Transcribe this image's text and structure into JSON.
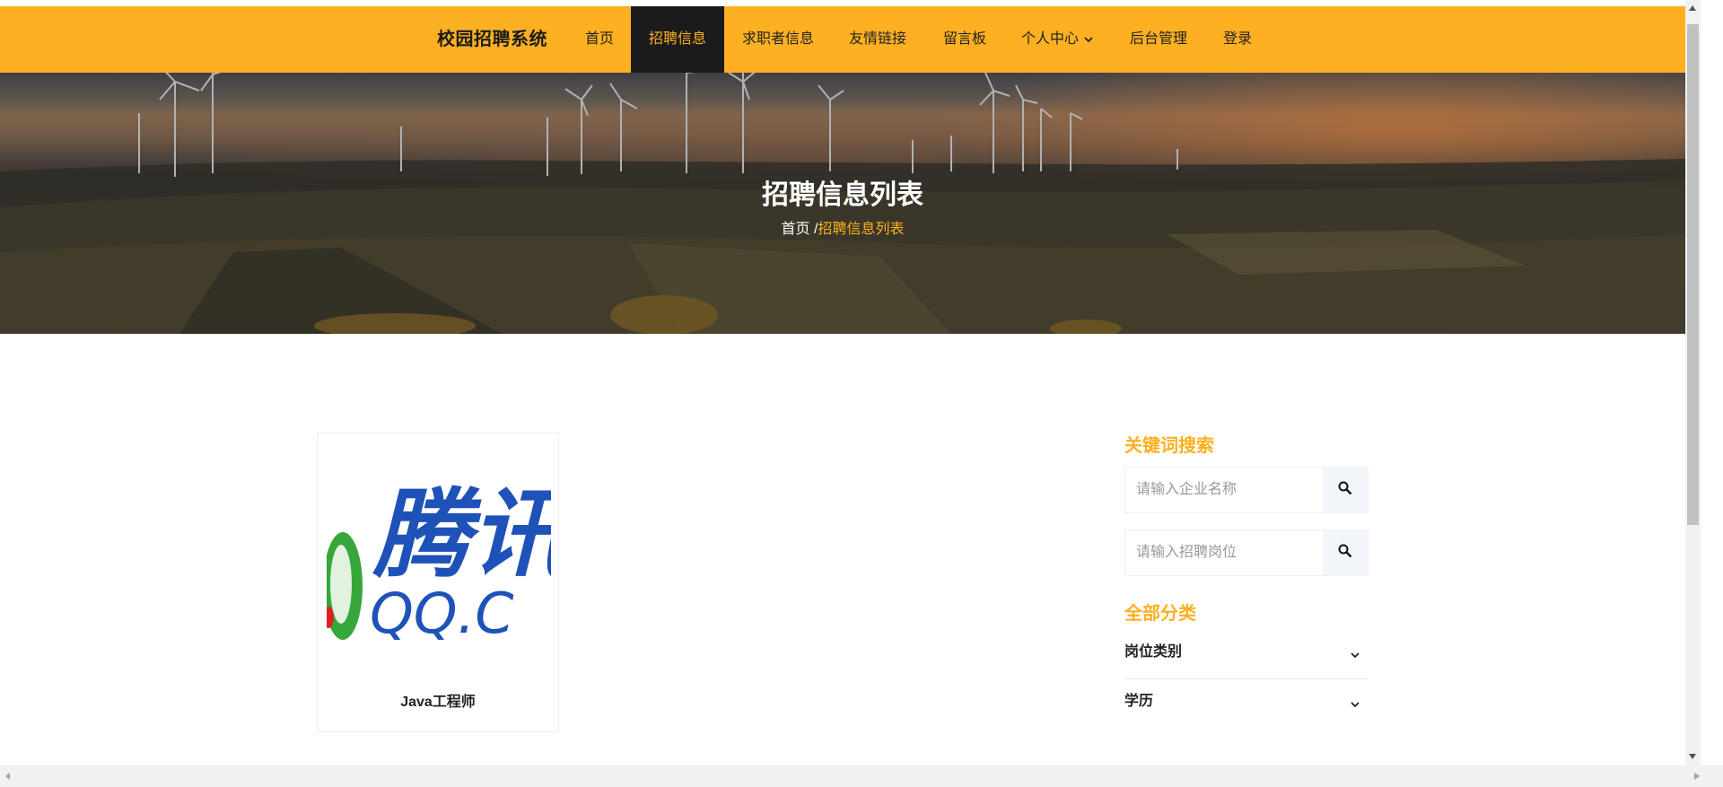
{
  "app": {
    "title": "校园招聘系统"
  },
  "nav": {
    "items": [
      {
        "label": "首页"
      },
      {
        "label": "招聘信息"
      },
      {
        "label": "求职者信息"
      },
      {
        "label": "友情链接"
      },
      {
        "label": "留言板"
      },
      {
        "label": "个人中心"
      },
      {
        "label": "后台管理"
      },
      {
        "label": "登录"
      }
    ],
    "active": "招聘信息"
  },
  "hero": {
    "title": "招聘信息列表",
    "breadcrumb": {
      "home": "首页",
      "separator": "/",
      "current": "招聘信息列表"
    }
  },
  "listing": {
    "cards": [
      {
        "title": "Java工程师",
        "logo_text_top": "腾讯",
        "logo_text_bottom": "QQ.C"
      }
    ]
  },
  "sidebar": {
    "search_heading": "关键词搜索",
    "company_placeholder": "请输入企业名称",
    "position_placeholder": "请输入招聘岗位",
    "category_heading": "全部分类",
    "categories": [
      {
        "label": "岗位类别"
      },
      {
        "label": "学历"
      }
    ]
  },
  "colors": {
    "accent": "#fdb022",
    "nav_active_bg": "#1b1b1b"
  }
}
